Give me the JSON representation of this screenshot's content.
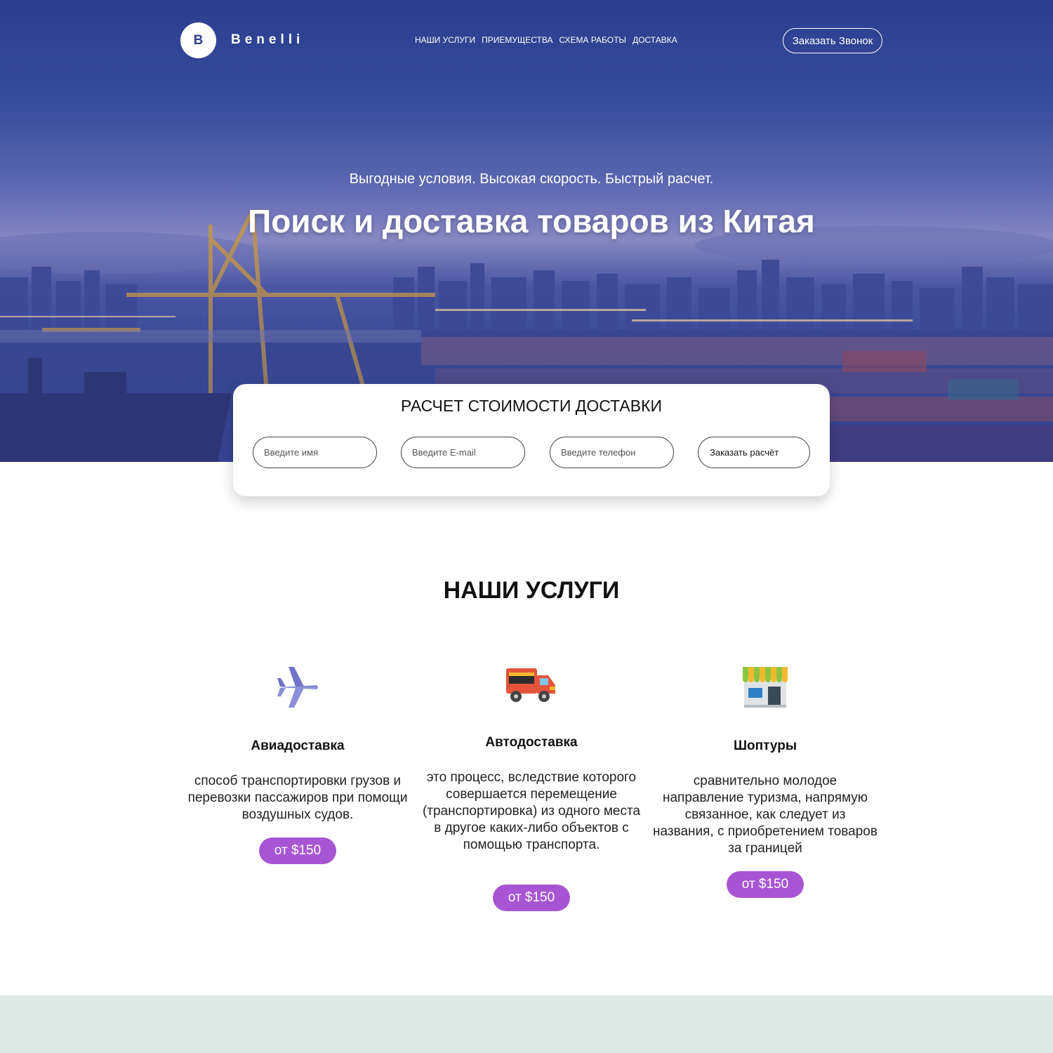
{
  "header": {
    "logo_letter": "B",
    "brand": "Benelli",
    "nav": [
      "НАШИ УСЛУГИ",
      "ПРИЕМУЩЕСТВА",
      "СХЕМА РАБОТЫ",
      "ДОСТАВКА"
    ],
    "call_button": "Заказать Звонок"
  },
  "hero": {
    "subtitle": "Выгодные условия. Высокая скорость. Быстрый расчет.",
    "title": "Поиск и доставка товаров из Китая"
  },
  "calc": {
    "title": "РАСЧЕТ СТОИМОСТИ ДОСТАВКИ",
    "name_placeholder": "Введите имя",
    "email_placeholder": "Введите E-mail",
    "phone_placeholder": "Введите телефон",
    "submit": "Заказать расчёт"
  },
  "services": {
    "title": "НАШИ УСЛУГИ",
    "items": [
      {
        "icon": "airplane-icon",
        "name": "Авиадоставка",
        "description": "способ транспортировки грузов и перевозки пассажиров при помощи воздушных судов.",
        "price": "от $150"
      },
      {
        "icon": "truck-icon",
        "name": "Автодоставка",
        "description": "это процесс, вследствие которого совершается перемещение (транспортировка) из одного места в другое каких-либо объектов с помощью транспорта.",
        "price": "от $150"
      },
      {
        "icon": "shop-icon",
        "name": "Шоптуры",
        "description": "сравнительно молодое направление туризма, напрямую связанное, как следует из названия, с приобретением товаров за границей",
        "price": "от $150"
      }
    ]
  },
  "colors": {
    "hero_blue": "#2f3f8e",
    "price_badge": "#a855d3",
    "bottom_band": "#dfe9e6"
  }
}
